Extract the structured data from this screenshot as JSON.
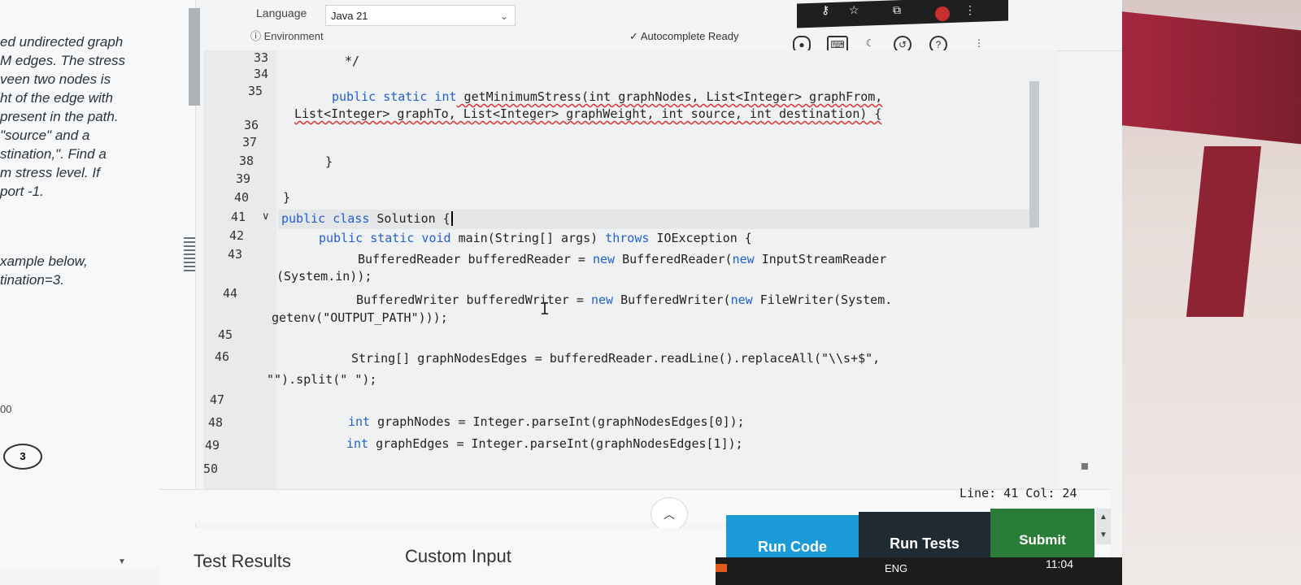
{
  "problem": {
    "lines": [
      "ed undirected graph",
      "M edges. The stress",
      "veen two nodes is",
      "ht of the edge with",
      " present in the path.",
      " \"source\" and a",
      "stination,\". Find a",
      "m stress level. If",
      "port -1."
    ],
    "example_lines": [
      "xample below,",
      "tination=3."
    ],
    "fragment": "00",
    "node_label": "3"
  },
  "toolbar": {
    "language_label": "Language",
    "language_value": "Java 21",
    "environment_label": "Environment",
    "autocomplete": "Autocomplete Ready"
  },
  "editor": {
    "line_numbers": [
      "33",
      "34",
      "35",
      "36",
      "37",
      "38",
      "39",
      "40",
      "41",
      "42",
      "43",
      "44",
      "45",
      "46",
      "47",
      "48",
      "49",
      "50"
    ],
    "code": {
      "l33": "*/",
      "l35_kw": "public static int",
      "l35_rest": " getMinimumStress(int graphNodes, List<Integer> graphFrom,",
      "l35b": "List<Integer> graphTo, List<Integer> graphWeight, int source, int destination) {",
      "l38": "}",
      "l40": "}",
      "l41_kw": "public class",
      "l41_rest": " Solution {",
      "l42_kw": "public static void",
      "l42_mid": " main(String[] args) ",
      "l42_kw2": "throws",
      "l42_rest": " IOException {",
      "l43a": "BufferedReader bufferedReader = ",
      "l43_kw": "new",
      "l43b": " BufferedReader(",
      "l43_kw2": "new",
      "l43c": " InputStreamReader",
      "l43d": "(System.in));",
      "l44a": "BufferedWriter bufferedWriter = ",
      "l44_kw": "new",
      "l44b": " BufferedWriter(",
      "l44_kw2": "new",
      "l44c": " FileWriter(System.",
      "l44d": "getenv(\"OUTPUT_PATH\")));",
      "l46a": "String[] graphNodesEdges = bufferedReader.readLine().replaceAll(\"\\\\s+$\",",
      "l46b": "\"\").split(\" \");",
      "l48_kw": "int",
      "l48_rest": " graphNodes = Integer.parseInt(graphNodesEdges[0]);",
      "l49_kw": "int",
      "l49_rest": " graphEdges = Integer.parseInt(graphNodesEdges[1]);"
    }
  },
  "status": {
    "line_col": "Line: 41 Col: 24"
  },
  "bottom": {
    "tab_results": "Test Results",
    "tab_custom": "Custom Input",
    "run_code": "Run Code",
    "run_tests": "Run Tests",
    "submit": "Submit"
  },
  "taskbar": {
    "lang": "ENG",
    "time": "11:04"
  },
  "colors": {
    "keyword": "#1e5fd4",
    "run_button": "#1b9ad8",
    "tests_button": "#202a33",
    "submit_button": "#2a7d39"
  },
  "icons": [
    "eye-icon",
    "keyboard-icon",
    "theme-icon",
    "history-icon",
    "help-icon",
    "more-icon",
    "chevron-down-icon",
    "check-circle-icon",
    "info-icon",
    "chevron-up-icon"
  ]
}
